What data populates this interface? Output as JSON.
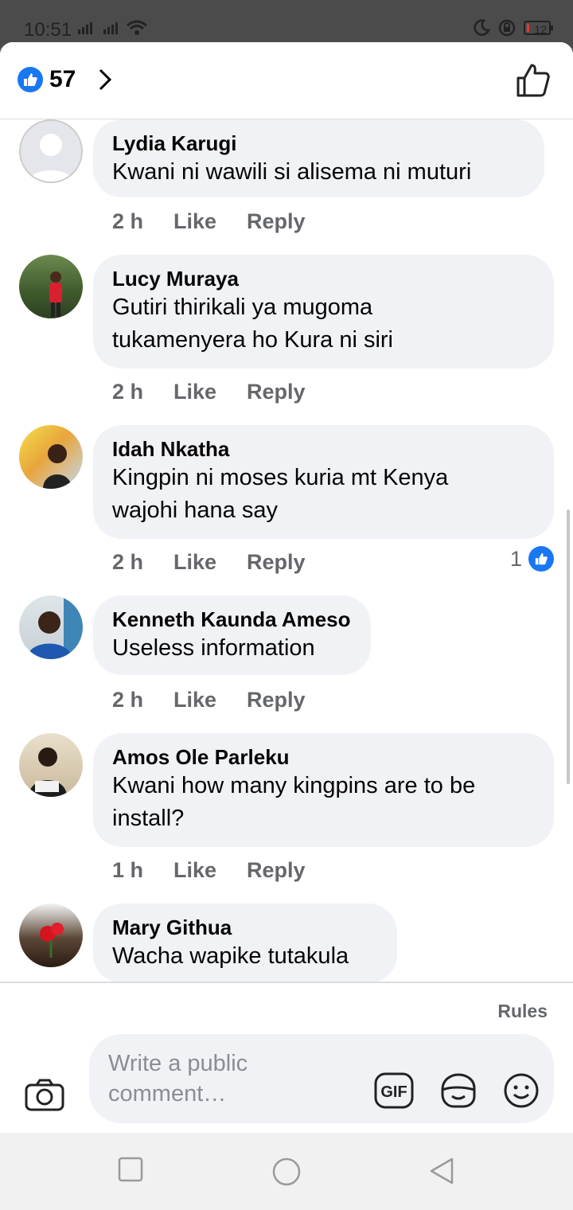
{
  "status": {
    "time": "10:51",
    "battery": "12"
  },
  "header": {
    "reaction_count": "57"
  },
  "comments": [
    {
      "name": "Lydia Karugi",
      "text_lines": [
        "Kwani ni wawili si alisema ni muturi"
      ],
      "time": "2 h",
      "like": "Like",
      "reply": "Reply"
    },
    {
      "name": "Lucy Muraya",
      "text_lines": [
        "Gutiri thirikali ya mugoma",
        "tukamenyera ho Kura ni siri"
      ],
      "time": "2 h",
      "like": "Like",
      "reply": "Reply"
    },
    {
      "name": "Idah Nkatha",
      "text_lines": [
        "Kingpin ni moses kuria mt Kenya",
        "wajohi hana say"
      ],
      "time": "2 h",
      "like": "Like",
      "reply": "Reply",
      "reaction_count": "1"
    },
    {
      "name": "Kenneth Kaunda Ameso",
      "text_lines": [
        "Useless information"
      ],
      "time": "2 h",
      "like": "Like",
      "reply": "Reply"
    },
    {
      "name": "Amos Ole Parleku",
      "text_lines": [
        "Kwani how many kingpins are to be",
        "install?"
      ],
      "time": "1 h",
      "like": "Like",
      "reply": "Reply"
    },
    {
      "name": "Mary Githua",
      "text_lines": [
        "Wacha wapike tutakula"
      ]
    }
  ],
  "composer": {
    "rules": "Rules",
    "placeholder_lines": [
      "Write a public",
      "comment…"
    ],
    "gif_label": "GIF"
  },
  "colors": {
    "brand": "#1877f2",
    "bubble": "#f0f2f5",
    "muted": "#65676b"
  },
  "icons": [
    "like-icon",
    "chevron-right-icon",
    "thumbs-up-icon",
    "camera-icon",
    "gif-icon",
    "sticker-icon",
    "emoji-icon",
    "recent-apps-icon",
    "home-icon",
    "back-icon"
  ]
}
